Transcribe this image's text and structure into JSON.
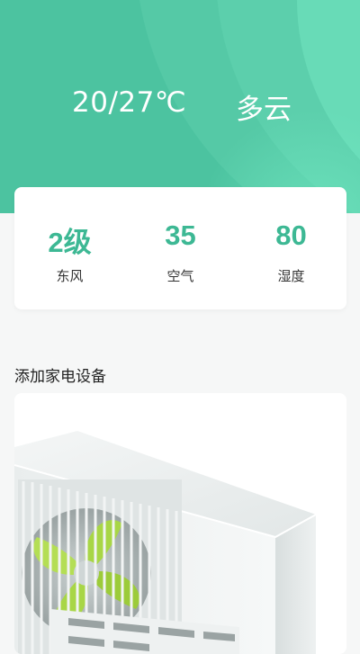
{
  "weather": {
    "temperature": "20/27℃",
    "condition": "多云"
  },
  "stats": [
    {
      "value": "2级",
      "label": "东风"
    },
    {
      "value": "35",
      "label": "空气"
    },
    {
      "value": "80",
      "label": "湿度"
    }
  ],
  "devices": {
    "section_title": "添加家电设备",
    "first_device_icon": "air-conditioner-outdoor-unit"
  },
  "colors": {
    "header_green": "#4cc3a0",
    "accent_green": "#3db894",
    "page_background": "#f6f7f7",
    "fan_blade": "#a8d646"
  }
}
